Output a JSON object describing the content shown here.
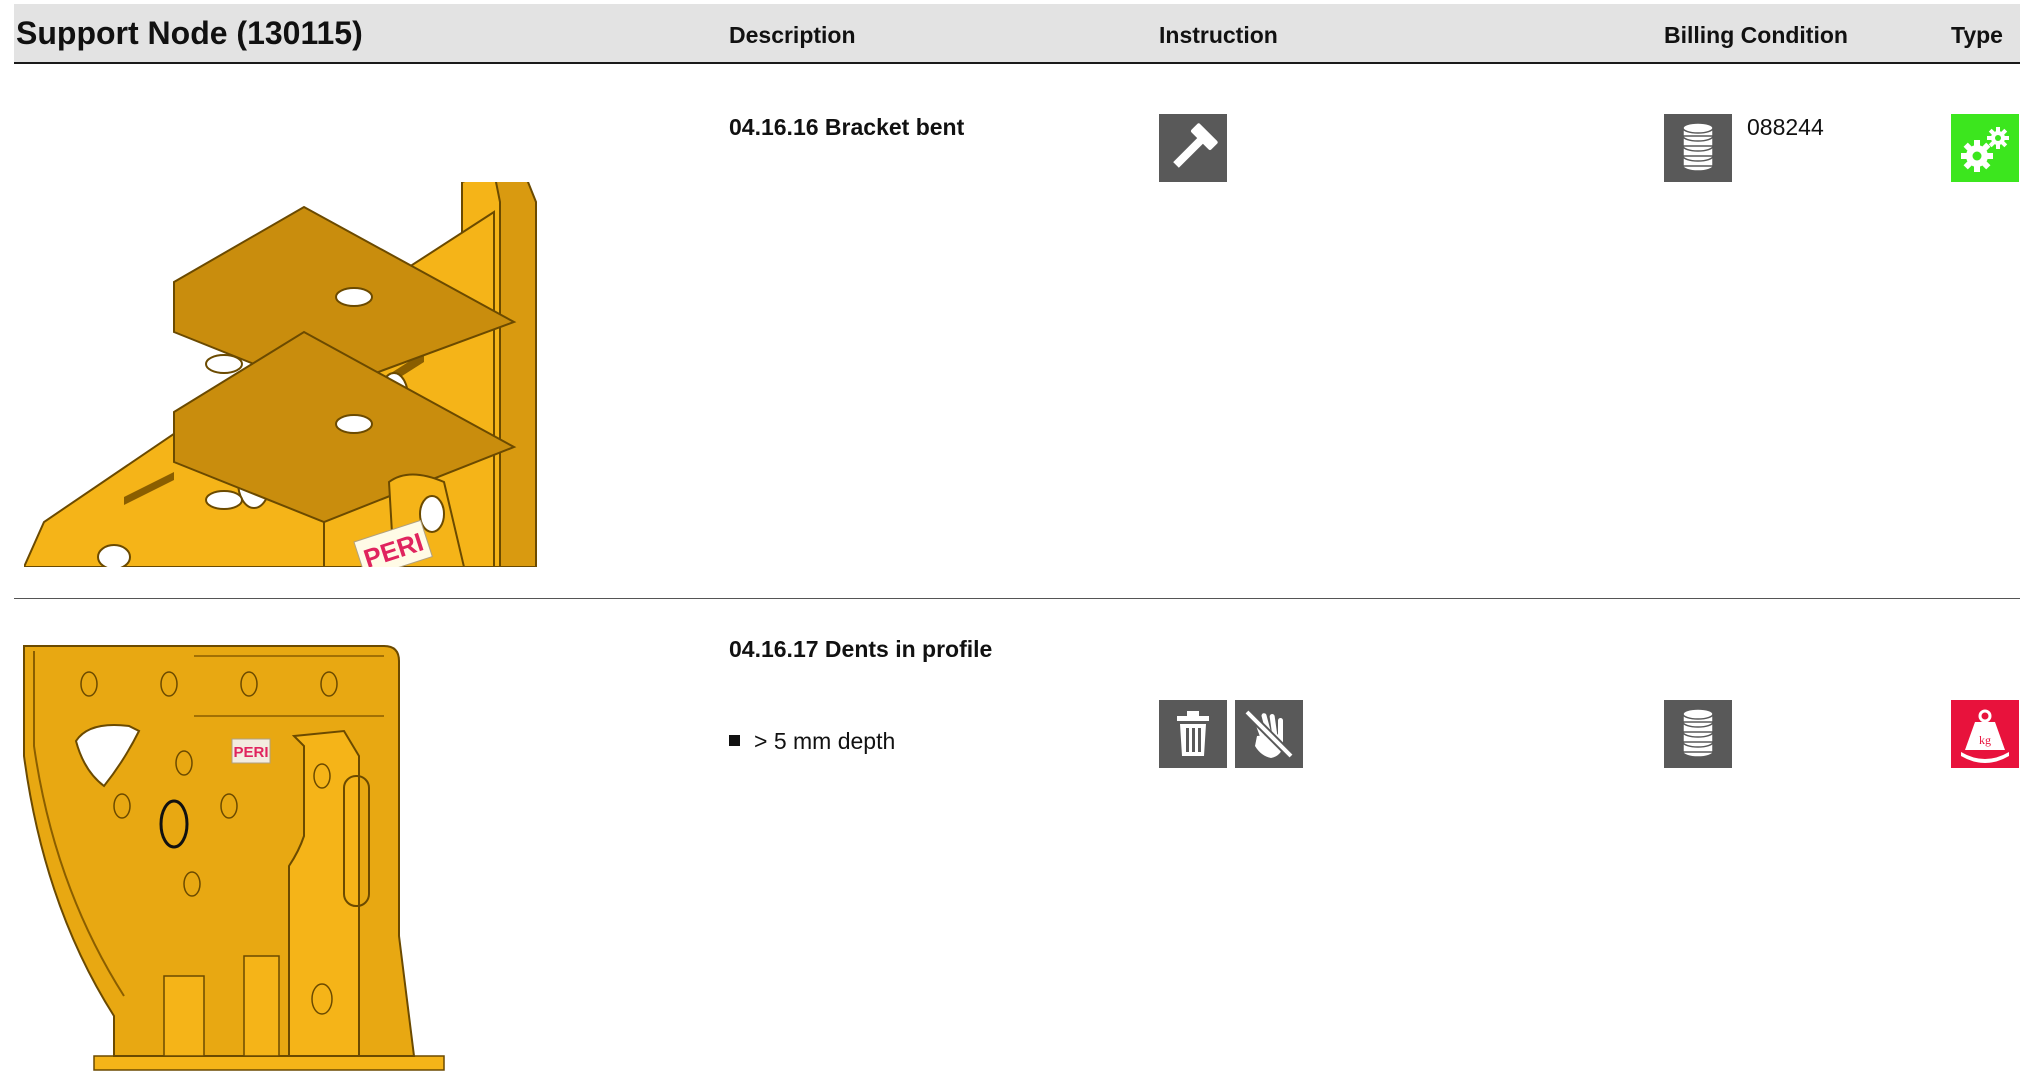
{
  "header": {
    "title": "Support Node (130115)",
    "col_description": "Description",
    "col_instruction": "Instruction",
    "col_billing": "Billing Condition",
    "col_type": "Type"
  },
  "rows": [
    {
      "description_title": "04.16.16 Bracket bent",
      "instruction_icons": [
        "hammer-icon"
      ],
      "billing_icon": "coin-stack-icon",
      "billing_code": "088244",
      "type_icon": "gears-icon",
      "type_color": "#3ce61e",
      "image_logo": "PERI"
    },
    {
      "description_title": "04.16.17 Dents in profile",
      "bullets": [
        "> 5 mm depth"
      ],
      "instruction_icons": [
        "trash-icon",
        "no-hand-icon"
      ],
      "billing_icon": "coin-stack-icon",
      "billing_code": "",
      "type_icon": "weight-kg-icon",
      "type_color": "#e8123c",
      "type_icon_label": "kg",
      "image_logo": "PERI"
    }
  ],
  "colors": {
    "icon_gray": "#595959",
    "header_bg": "#e3e3e3",
    "part_yellow": "#f5b418"
  }
}
